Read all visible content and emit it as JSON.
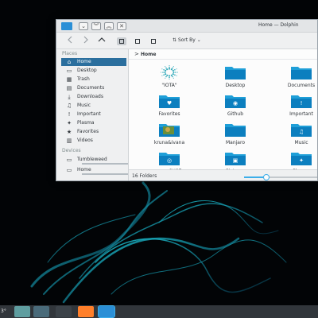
{
  "window": {
    "title": "Home — Dolphin",
    "buttons": {
      "shade": "⌄",
      "minimize": "︾",
      "maximize": "︽",
      "close": "✕"
    }
  },
  "toolbar": {
    "back_icon": "chevron-left-icon",
    "forward_icon": "chevron-right-icon",
    "up_icon": "chevron-up-icon",
    "sort_label": "Sort By",
    "sort_chevron": "⌄"
  },
  "sidebar": {
    "places_heading": "Places",
    "devices_heading": "Devices",
    "places": [
      {
        "label": "Home",
        "icon": "home-icon",
        "glyph": "⌂",
        "selected": true
      },
      {
        "label": "Desktop",
        "icon": "desktop-icon",
        "glyph": "▭"
      },
      {
        "label": "Trash",
        "icon": "trash-icon",
        "glyph": "▦"
      },
      {
        "label": "Documents",
        "icon": "documents-icon",
        "glyph": "▤"
      },
      {
        "label": "Downloads",
        "icon": "downloads-icon",
        "glyph": "⤓"
      },
      {
        "label": "Music",
        "icon": "music-icon",
        "glyph": "♫"
      },
      {
        "label": "Important",
        "icon": "important-icon",
        "glyph": "!"
      },
      {
        "label": "Plasma",
        "icon": "plasma-icon",
        "glyph": "✦"
      },
      {
        "label": "Favorites",
        "icon": "favorites-icon",
        "glyph": "★"
      },
      {
        "label": "Videos",
        "icon": "videos-icon",
        "glyph": "▥"
      }
    ],
    "devices": [
      {
        "label": "Tumbleweed",
        "icon": "drive-icon",
        "glyph": "▭"
      },
      {
        "label": "Home",
        "icon": "drive-icon",
        "glyph": "▭"
      }
    ]
  },
  "path": {
    "chevron": ">",
    "crumb": "Home"
  },
  "files": [
    {
      "label": "\"IOTA\"",
      "kind": "iota-logo"
    },
    {
      "label": "Desktop",
      "kind": "folder",
      "emblem": ""
    },
    {
      "label": "Documents",
      "kind": "folder",
      "emblem": ""
    },
    {
      "label": "Favorites",
      "kind": "folder",
      "emblem": "♥"
    },
    {
      "label": "Github",
      "kind": "folder",
      "emblem": "◉"
    },
    {
      "label": "Important",
      "kind": "folder",
      "emblem": "!"
    },
    {
      "label": "kruna&ivana",
      "kind": "image-folder",
      "emblem": ""
    },
    {
      "label": "Manjaro",
      "kind": "folder",
      "emblem": ""
    },
    {
      "label": "Music",
      "kind": "folder",
      "emblem": "♫"
    },
    {
      "label": "openSUSE",
      "kind": "folder",
      "emblem": "◎"
    },
    {
      "label": "Pictures",
      "kind": "folder",
      "emblem": "▣"
    },
    {
      "label": "Plasma",
      "kind": "folder",
      "emblem": "✦"
    }
  ],
  "status": {
    "text": "16 Folders",
    "zoom_level": 0.3
  },
  "taskbar": {
    "clock_fragment": "3°",
    "tasks": [
      {
        "name": "task-image-viewer",
        "color": "#5f9ea0"
      },
      {
        "name": "task-gallery",
        "color": "#4a6b7a"
      },
      {
        "name": "task-system-settings",
        "color": "#3b4248"
      },
      {
        "name": "task-firefox",
        "color": "#ff7f2a"
      },
      {
        "name": "task-dolphin",
        "color": "#2b8fd6",
        "active": true
      }
    ]
  },
  "colors": {
    "accent": "#3daee9",
    "selection": "#2b6f9e",
    "folder_top": "#1f9fd8",
    "folder_body": "#0c7fbf"
  }
}
